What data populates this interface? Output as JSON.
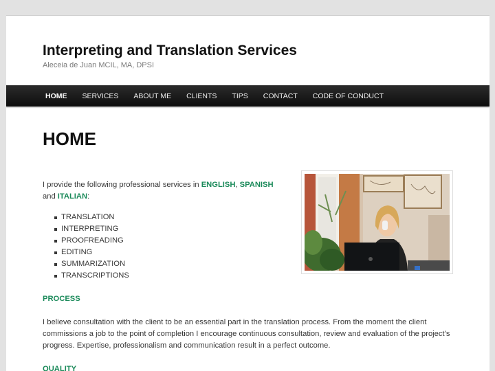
{
  "site": {
    "title": "Interpreting and Translation Services",
    "description": "Aleceia de Juan MCIL, MA, DPSI"
  },
  "nav": {
    "items": [
      {
        "label": "HOME",
        "active": true
      },
      {
        "label": "SERVICES"
      },
      {
        "label": "ABOUT ME"
      },
      {
        "label": "CLIENTS"
      },
      {
        "label": "TIPS"
      },
      {
        "label": "CONTACT"
      },
      {
        "label": "CODE OF CONDUCT"
      }
    ]
  },
  "page": {
    "title": "HOME",
    "intro": {
      "prefix": "I provide the following professional services in ",
      "lang1": "ENGLISH",
      "sep1": ", ",
      "lang2": "SPANISH",
      "sep2": " and ",
      "lang3": "ITALIAN",
      "suffix": ":"
    },
    "services": [
      "TRANSLATION",
      "INTERPRETING",
      "PROOFREADING",
      "EDITING",
      "SUMMARIZATION",
      "TRANSCRIPTIONS"
    ],
    "process_heading": "PROCESS",
    "process_text": "I believe consultation with the client to be an essential part in the translation process. From the moment the client commissions a job to the point of completion I encourage continuous consultation, review and evaluation of the project’s progress.  Expertise, professionalism and communication result in a perfect outcome.",
    "quality_heading": "QUALITY"
  },
  "colors": {
    "accent": "#1b8a5a",
    "nav_bg": "#1c1c1c",
    "page_bg": "#ffffff",
    "body_bg": "#e2e2e2"
  }
}
